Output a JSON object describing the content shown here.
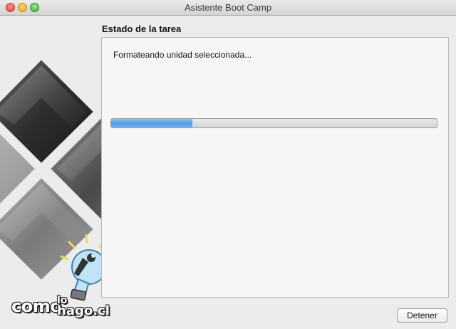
{
  "window": {
    "title": "Asistente Boot Camp"
  },
  "section": {
    "heading": "Estado de la tarea"
  },
  "task": {
    "status_text": "Formateando unidad seleccionada...",
    "progress_fraction": 0.25
  },
  "buttons": {
    "stop_label": "Detener"
  },
  "watermark": {
    "word1": "como",
    "word2": "lo",
    "word3": "hago.cl"
  },
  "colors": {
    "progress_fill": "#4f9be6",
    "window_background": "#ececec",
    "panel_background": "#f6f6f6"
  }
}
